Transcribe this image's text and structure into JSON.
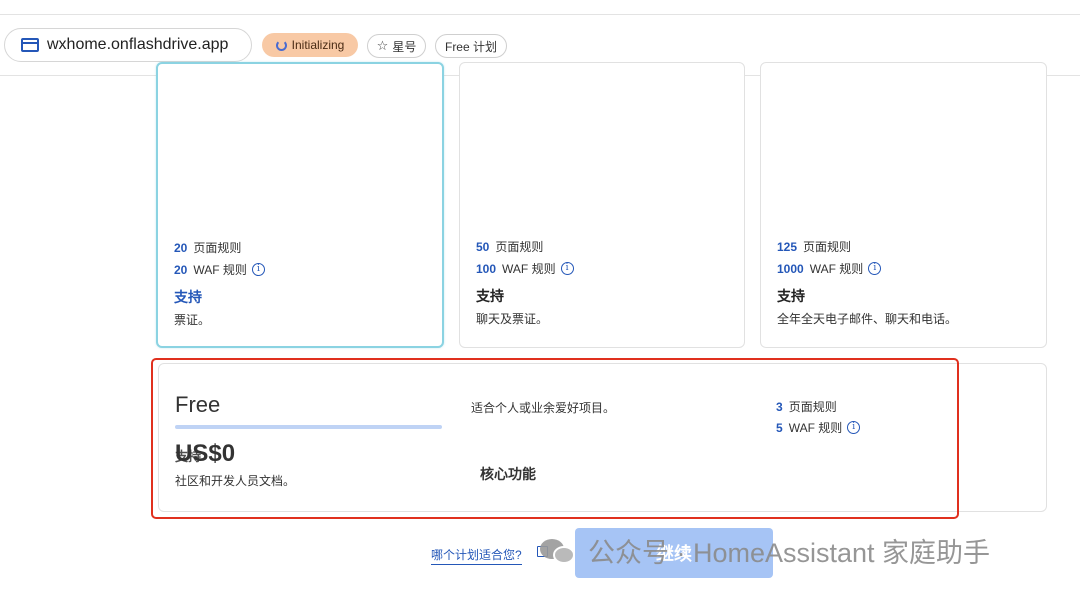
{
  "toolbar": {
    "domain": "wxhome.onflashdrive.app",
    "status_badge": "Initializing",
    "star_label": "星号",
    "plan_label": "Free 计划"
  },
  "plans": [
    {
      "page_rules_count": "20",
      "page_rules_label": "页面规则",
      "waf_count": "20",
      "waf_label": "WAF 规则",
      "support_heading": "支持",
      "support_text": "票证。"
    },
    {
      "page_rules_count": "50",
      "page_rules_label": "页面规则",
      "waf_count": "100",
      "waf_label": "WAF 规则",
      "support_heading": "支持",
      "support_text": "聊天及票证。"
    },
    {
      "page_rules_count": "125",
      "page_rules_label": "页面规则",
      "waf_count": "1000",
      "waf_label": "WAF 规则",
      "support_heading": "支持",
      "support_text": "全年全天电子邮件、聊天和电话。"
    }
  ],
  "free_plan": {
    "name": "Free",
    "price": "US$0",
    "support_heading": "支持",
    "support_text": "社区和开发人员文档。",
    "description": "适合个人或业余爱好项目。",
    "core_features": "核心功能",
    "page_rules_count": "3",
    "page_rules_label": "页面规则",
    "waf_count": "5",
    "waf_label": "WAF 规则"
  },
  "footer": {
    "help_link": "哪个计划适合您?",
    "continue_button": "继续"
  },
  "watermark": {
    "text": "公众号 · HomeAssistant 家庭助手"
  },
  "colors": {
    "accent": "#2457b8",
    "highlight_box": "#e0301e",
    "selected_card": "#8bd3e2",
    "initializing_badge": "#f8c9a5",
    "continue_button": "#a6c4f5"
  }
}
